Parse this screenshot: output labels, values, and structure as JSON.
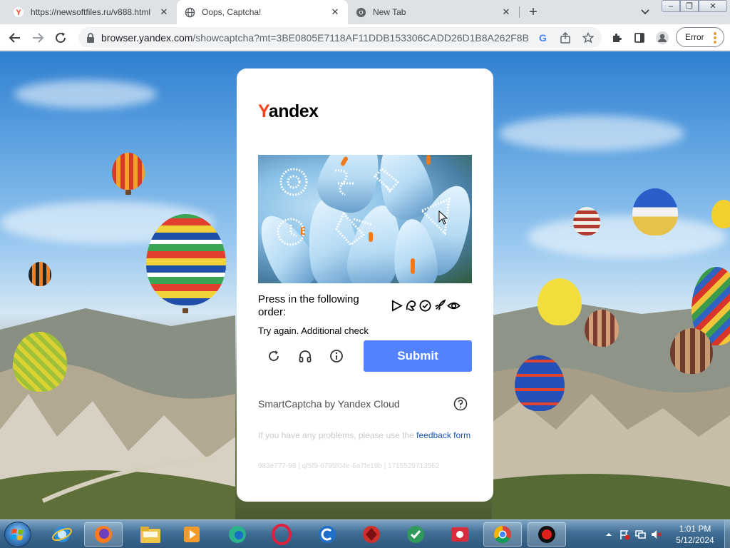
{
  "browser": {
    "tabs": [
      {
        "title": "https://newsoftfiles.ru/v888.html",
        "favicon": "yandex-favicon",
        "active": false
      },
      {
        "title": "Oops, Captcha!",
        "favicon": "globe-icon",
        "active": true
      },
      {
        "title": "New Tab",
        "favicon": "chrome-icon",
        "active": false
      }
    ],
    "address": {
      "host": "browser.yandex.com",
      "path": "/showcaptcha?mt=3BE0805E7118AF11DDB153306CADD26D1B8A262F8B3..."
    },
    "profile_button": "Error",
    "window_controls": {
      "minimize": "–",
      "restore": "❐",
      "close": "✕"
    }
  },
  "captcha": {
    "logo": {
      "y": "Y",
      "rest": "andex"
    },
    "prompt": "Press in the following order:",
    "sequence_icons": [
      "play-triangle-icon",
      "leaf-hand-icon",
      "check-circle-icon",
      "rocket-icon",
      "eye-icon"
    ],
    "notice": "Try again. Additional check",
    "submit_label": "Submit",
    "brand_line": "SmartCaptcha by Yandex Cloud",
    "feedback_text": "If you have any problems, please use the ",
    "feedback_link": "feedback form",
    "request_id": "983e777-98 | qf5f9-6795f04e-6a7fe19b | 1715529713562"
  },
  "taskbar": {
    "apps": [
      "ie-icon",
      "firefox-icon",
      "explorer-icon",
      "media-player-icon",
      "edge-icon",
      "opera-icon",
      "ccleaner-icon",
      "kaspersky-icon",
      "malware-icon",
      "recorder-icon",
      "chrome-icon",
      "record-icon"
    ],
    "time": "1:01 PM",
    "date": "5/12/2024"
  },
  "colors": {
    "submit": "#5282ff",
    "yandex_red": "#fc3f1d",
    "link": "#1a56b6",
    "tab_strip": "#dee1e6"
  }
}
